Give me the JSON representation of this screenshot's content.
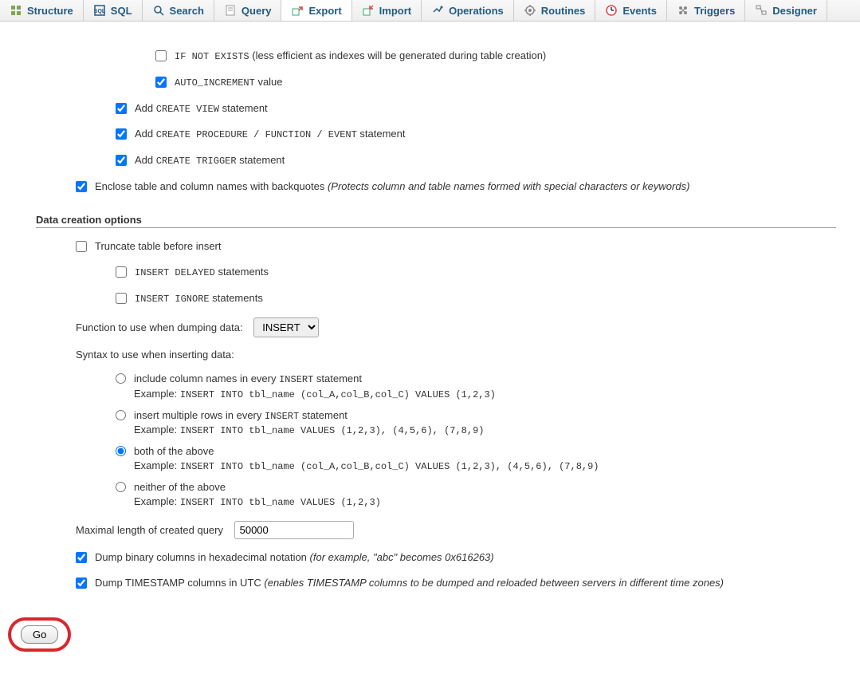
{
  "tabs": [
    {
      "label": "Structure",
      "icon": "structure"
    },
    {
      "label": "SQL",
      "icon": "sql"
    },
    {
      "label": "Search",
      "icon": "search"
    },
    {
      "label": "Query",
      "icon": "query"
    },
    {
      "label": "Export",
      "icon": "export"
    },
    {
      "label": "Import",
      "icon": "import"
    },
    {
      "label": "Operations",
      "icon": "operations"
    },
    {
      "label": "Routines",
      "icon": "routines"
    },
    {
      "label": "Events",
      "icon": "events"
    },
    {
      "label": "Triggers",
      "icon": "triggers"
    },
    {
      "label": "Designer",
      "icon": "designer"
    }
  ],
  "active_tab_index": 4,
  "options": {
    "if_not_exists": {
      "code": "IF NOT EXISTS",
      "text": " (less efficient as indexes will be generated during table creation)"
    },
    "auto_increment": {
      "code": "AUTO_INCREMENT",
      "text": " value"
    },
    "create_view": {
      "pre": "Add ",
      "code": "CREATE VIEW",
      "post": " statement"
    },
    "create_procedure": {
      "pre": "Add ",
      "code": "CREATE PROCEDURE / FUNCTION / EVENT",
      "post": " statement"
    },
    "create_trigger": {
      "pre": "Add ",
      "code": "CREATE TRIGGER",
      "post": " statement"
    },
    "backquotes": {
      "text": "Enclose table and column names with backquotes ",
      "note": "(Protects column and table names formed with special characters or keywords)"
    }
  },
  "data_section_title": "Data creation options",
  "data_options": {
    "truncate": "Truncate table before insert",
    "insert_delayed": {
      "code": "INSERT DELAYED",
      "text": " statements"
    },
    "insert_ignore": {
      "code": "INSERT IGNORE",
      "text": " statements"
    }
  },
  "function_label": "Function to use when dumping data:",
  "function_options": [
    "INSERT"
  ],
  "function_selected": "INSERT",
  "syntax_label": "Syntax to use when inserting data:",
  "syntax_options": [
    {
      "label_pre": "include column names in every ",
      "label_code": "INSERT",
      "label_post": " statement",
      "example_label": "Example: ",
      "example": "INSERT INTO tbl_name (col_A,col_B,col_C) VALUES (1,2,3)"
    },
    {
      "label_pre": "insert multiple rows in every ",
      "label_code": "INSERT",
      "label_post": " statement",
      "example_label": "Example: ",
      "example": "INSERT INTO tbl_name VALUES (1,2,3), (4,5,6), (7,8,9)"
    },
    {
      "label_pre": "both of the above",
      "label_code": "",
      "label_post": "",
      "example_label": "Example: ",
      "example": "INSERT INTO tbl_name (col_A,col_B,col_C) VALUES (1,2,3), (4,5,6), (7,8,9)"
    },
    {
      "label_pre": "neither of the above",
      "label_code": "",
      "label_post": "",
      "example_label": "Example: ",
      "example": "INSERT INTO tbl_name VALUES (1,2,3)"
    }
  ],
  "syntax_selected_index": 2,
  "maxlen_label": "Maximal length of created query",
  "maxlen_value": "50000",
  "hex": {
    "text": "Dump binary columns in hexadecimal notation ",
    "note": "(for example, \"abc\" becomes 0x616263)"
  },
  "utc": {
    "text": "Dump TIMESTAMP columns in UTC ",
    "note": "(enables TIMESTAMP columns to be dumped and reloaded between servers in different time zones)"
  },
  "go_label": "Go"
}
